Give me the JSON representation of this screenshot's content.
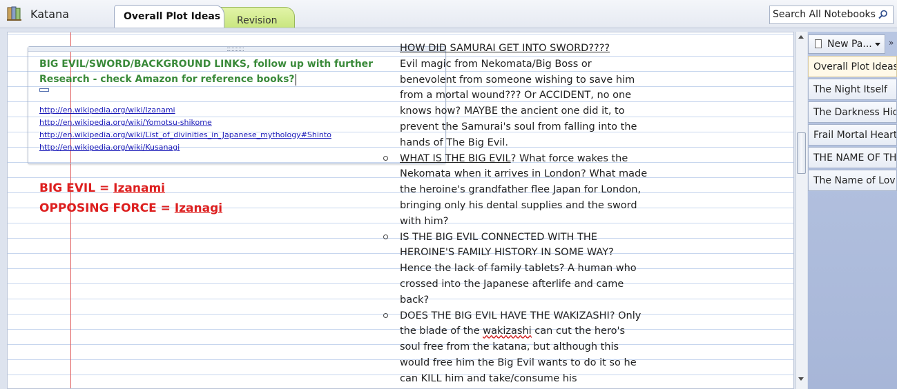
{
  "header": {
    "notebook_name": "Katana",
    "tabs": [
      {
        "label": "Overall Plot Ideas",
        "active": true
      },
      {
        "label": "Revision",
        "active": false
      }
    ],
    "search_placeholder": "Search All Notebooks"
  },
  "note": {
    "heading": "BIG EVIL/SWORD/BACKGROUND LINKS, follow up with further Research - check Amazon for reference books?",
    "links": [
      "http://en.wikipedia.org/wiki/Izanami",
      "http://en.wikipedia.org/wiki/Yomotsu-shikome",
      "http://en.wikipedia.org/wiki/List_of_divinities_in_Japanese_mythology#Shinto",
      "http://en.wikipedia.org/wiki/Kusanagi"
    ],
    "big_evil_label": "BIG EVIL = ",
    "big_evil_value": "Izanami",
    "opposing_label": "OPPOSING FORCE = ",
    "opposing_value": "Izanagi"
  },
  "column": {
    "q1_title": "HOW DID SAMURAI GET INTO SWORD????",
    "q1_body": "Evil magic from Nekomata/Big Boss or benevolent from someone wishing to save him from a mortal wound??? Or ACCIDENT, no one knows how? MAYBE the ancient one did it, to prevent the Samurai's soul from falling into the hands of The Big Evil.",
    "q2_title": "WHAT IS THE BIG EVIL",
    "q2_body": "? What force wakes the Nekomata when it arrives in London? What made the heroine's grandfather flee Japan for London, bringing only his dental supplies and the sword with him?",
    "q3_body": "IS THE BIG EVIL CONNECTED  WITH THE HEROINE'S FAMILY HISTORY IN SOME WAY? Hence the lack of family tablets? A human who crossed into the Japanese afterlife and came back?",
    "q4_body_a": "DOES THE BIG EVIL HAVE THE WAKIZASHI? Only the blade of the ",
    "q4_word": "wakizashi",
    "q4_body_b": " can cut the hero's soul free from the katana, but although this would free him the Big Evil wants to do it so he can KILL him and take/consume his"
  },
  "pages_pane": {
    "new_page_label": "New Pa...",
    "pages": [
      {
        "label": "Overall Plot Ideas",
        "selected": true
      },
      {
        "label": "The Night Itself",
        "selected": false
      },
      {
        "label": "The Darkness Hid",
        "selected": false
      },
      {
        "label": "Frail Mortal Heart",
        "selected": false
      },
      {
        "label": "THE NAME OF TH",
        "selected": false
      },
      {
        "label": "The Name of Lov",
        "selected": false
      }
    ]
  },
  "colors": {
    "heading_green": "#3a8a3a",
    "red_text": "#dd1f1f",
    "link_blue": "#1a1ab8",
    "revision_tab": "#c9e680"
  },
  "icons": [
    "notebook-icon",
    "search-icon",
    "new-page-icon",
    "chevron-down-icon",
    "double-chevron-icon"
  ]
}
